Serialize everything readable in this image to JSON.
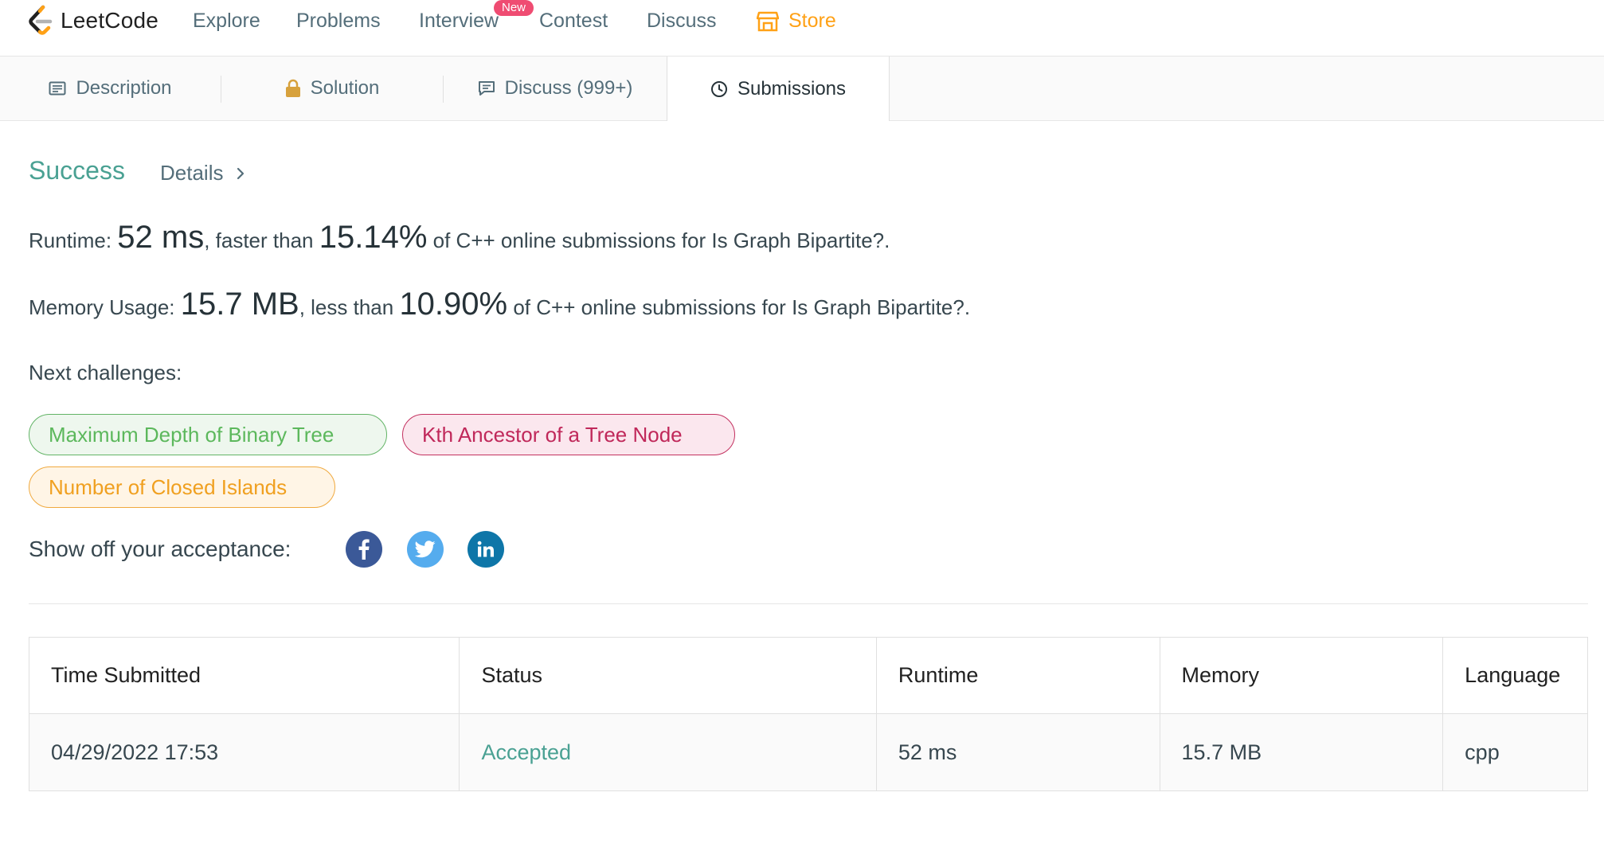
{
  "nav": {
    "logo_text": "LeetCode",
    "items": [
      "Explore",
      "Problems",
      "Interview",
      "Contest",
      "Discuss"
    ],
    "new_badge": "New",
    "store": "Store",
    "store_color": "#ffa116"
  },
  "tabs": [
    {
      "label": "Description",
      "icon": "description-icon"
    },
    {
      "label": "Solution",
      "icon": "lock-icon"
    },
    {
      "label": "Discuss (999+)",
      "icon": "comment-icon"
    },
    {
      "label": "Submissions",
      "icon": "clock-icon",
      "active": true
    }
  ],
  "result": {
    "status": "Success",
    "status_color": "#4aa193",
    "details": "Details",
    "runtime_label": "Runtime: ",
    "runtime_value": "52 ms",
    "runtime_mid": ", faster than ",
    "runtime_percent": "15.14%",
    "runtime_tail": " of C++ online submissions for Is Graph Bipartite?.",
    "memory_label": "Memory Usage: ",
    "memory_value": "15.7 MB",
    "memory_mid": ", less than ",
    "memory_percent": "10.90%",
    "memory_tail": " of C++ online submissions for Is Graph Bipartite?."
  },
  "next_challenges": {
    "label": "Next challenges:",
    "items": [
      {
        "title": "Maximum Depth of Binary Tree",
        "difficulty_color": "#5cb85c"
      },
      {
        "title": "Kth Ancestor of a Tree Node",
        "difficulty_color": "#c0285a"
      },
      {
        "title": "Number of Closed Islands",
        "difficulty_color": "#f0a020"
      }
    ]
  },
  "share": {
    "label": "Show off your acceptance:",
    "networks": [
      {
        "icon": "facebook-icon",
        "color": "#3b5998"
      },
      {
        "icon": "twitter-icon",
        "color": "#55acee"
      },
      {
        "icon": "linkedin-icon",
        "color": "#0e76a8"
      }
    ]
  },
  "submissions_table": {
    "headers": [
      "Time Submitted",
      "Status",
      "Runtime",
      "Memory",
      "Language"
    ],
    "rows": [
      [
        "04/29/2022 17:53",
        "Accepted",
        "52 ms",
        "15.7 MB",
        "cpp"
      ]
    ]
  }
}
